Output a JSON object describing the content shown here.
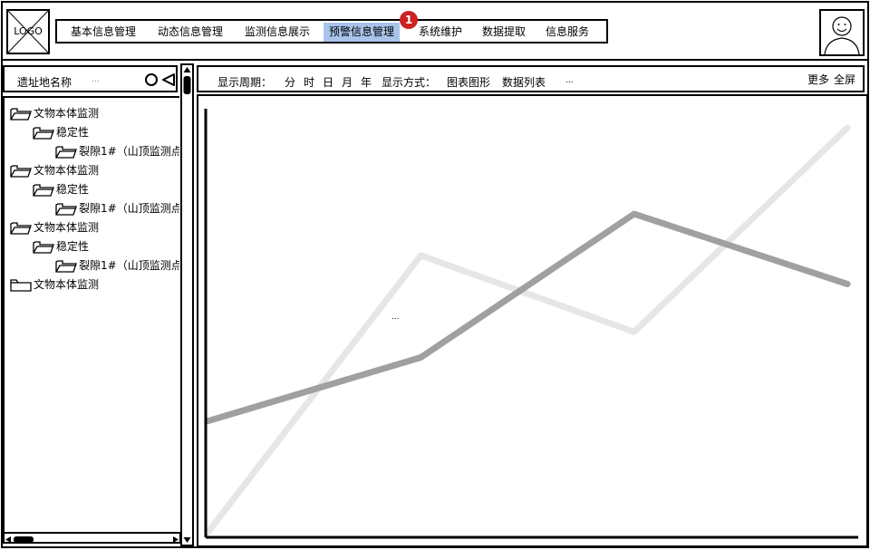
{
  "header": {
    "logo_text": "LOGO",
    "nav": [
      {
        "label": "基本信息管理",
        "active": false
      },
      {
        "label": "动态信息管理",
        "active": false
      },
      {
        "label": "监测信息展示",
        "active": false
      },
      {
        "label": "预警信息管理",
        "active": true
      },
      {
        "label": "系统维护",
        "active": false
      },
      {
        "label": "数据提取",
        "active": false
      },
      {
        "label": "信息服务",
        "active": false
      }
    ],
    "badge_count": "1"
  },
  "sidebar": {
    "search_label": "遗址地名称",
    "search_placeholder": "...",
    "tree": [
      {
        "label": "文物本体监测",
        "level": 0
      },
      {
        "label": "稳定性",
        "level": 1
      },
      {
        "label": "裂隙1#（山顶监测点",
        "level": 2
      },
      {
        "label": "文物本体监测",
        "level": 0
      },
      {
        "label": "稳定性",
        "level": 1
      },
      {
        "label": "裂隙1#（山顶监测点",
        "level": 2
      },
      {
        "label": "文物本体监测",
        "level": 0
      },
      {
        "label": "稳定性",
        "level": 1
      },
      {
        "label": "裂隙1#（山顶监测点",
        "level": 2
      },
      {
        "label": "文物本体监测",
        "level": 0
      }
    ]
  },
  "toolbar": {
    "period_label": "显示周期：",
    "periods": [
      "分",
      "时",
      "日",
      "月",
      "年"
    ],
    "mode_label": "显示方式：",
    "modes": [
      "图表图形",
      "数据列表"
    ],
    "ellipsis": "...",
    "more": "更多",
    "fullscreen": "全屏"
  },
  "chart": {
    "center_text": "..."
  },
  "chart_data": {
    "type": "line",
    "x": [
      0,
      1,
      2,
      3
    ],
    "series": [
      {
        "values": [
          0.35,
          0.55,
          1.0,
          0.78
        ],
        "color": "#a0a0a0"
      },
      {
        "values": [
          0.0,
          0.87,
          0.63,
          1.27
        ],
        "color": "#e6e6e6"
      }
    ],
    "ylim": [
      0,
      1.33
    ],
    "grid": false
  }
}
